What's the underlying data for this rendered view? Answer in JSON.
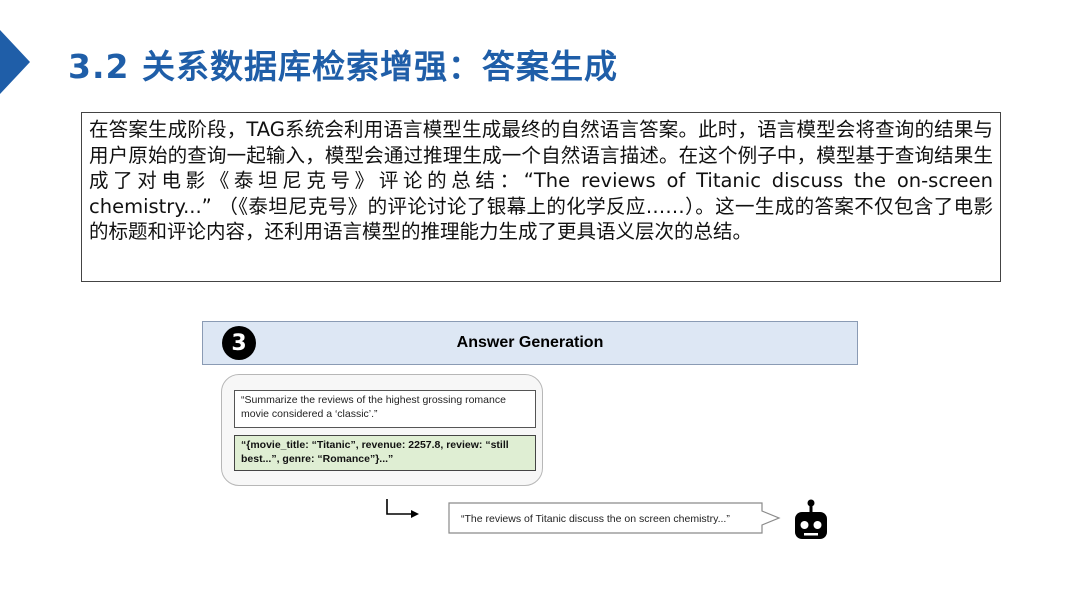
{
  "slide": {
    "title": "3.2 关系数据库检索增强：答案生成",
    "paragraph": "在答案生成阶段，TAG系统会利用语言模型生成最终的自然语言答案。此时，语言模型会将查询的结果与用户原始的查询一起输入，模型会通过推理生成一个自然语言描述。在这个例子中，模型基于查询结果生成了对电影《泰坦尼克号》评论的总结：“The reviews of Titanic discuss the on-screen chemistry...” （《泰坦尼克号》的评论讨论了银幕上的化学反应……）。这一生成的答案不仅包含了电影的标题和评论内容，还利用语言模型的推理能力生成了更具语义层次的总结。"
  },
  "figure": {
    "step_number": "3",
    "step_title": "Answer Generation",
    "query_text": "“Summarize the reviews of the highest grossing romance movie considered a ‘classic’.”",
    "result_text": "“{movie_title: “Titanic”, revenue: 2257.8, review: “still best...”, genre: “Romance”}...”",
    "answer_text": "“The reviews of Titanic discuss the on screen chemistry...”"
  },
  "colors": {
    "title": "#1f5ea8",
    "marker": "#1f5ea8",
    "bar_fill": "#dde7f4",
    "result_fill": "#dfeed3"
  },
  "icons": [
    "title-marker-icon",
    "elbow-arrow-icon",
    "robot-icon"
  ]
}
